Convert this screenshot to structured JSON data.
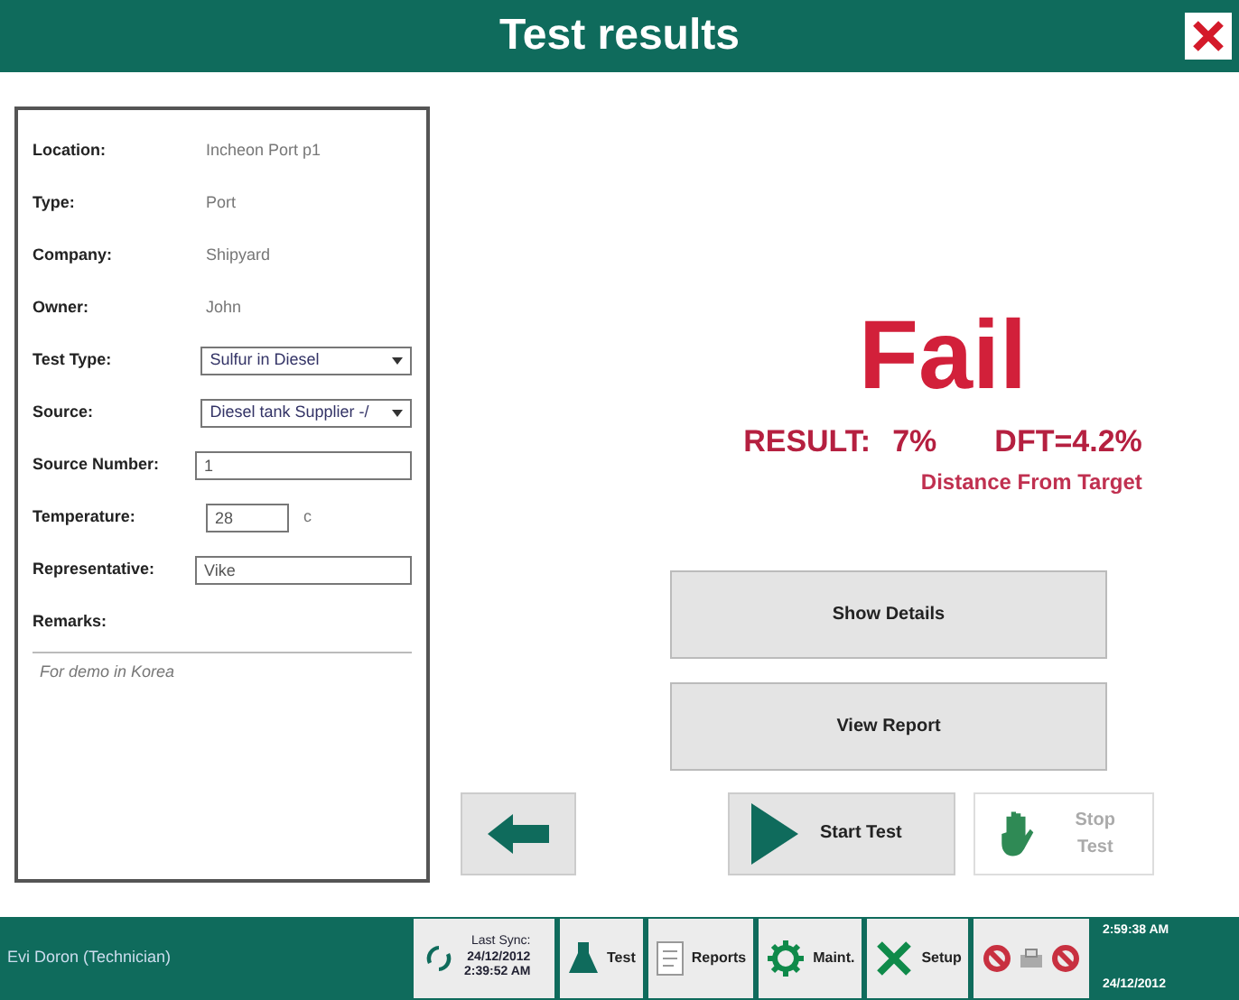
{
  "window": {
    "title": "Test results"
  },
  "fields": [
    {
      "label": "Location:",
      "kind": "text",
      "value": "Incheon Port p1"
    },
    {
      "label": "Type:",
      "kind": "text",
      "value": "Port"
    },
    {
      "label": "Company:",
      "kind": "text",
      "value": "Shipyard"
    },
    {
      "label": "Owner:",
      "kind": "text",
      "value": "John"
    },
    {
      "label": "Test Type:",
      "kind": "select",
      "value": "Sulfur in Diesel"
    },
    {
      "label": "Source:",
      "kind": "select",
      "value": "Diesel tank Supplier -/"
    },
    {
      "label": "Source Number:",
      "kind": "input",
      "value": "1"
    },
    {
      "label": "Temperature:",
      "kind": "input",
      "value": "28",
      "unit": "c"
    },
    {
      "label": "Representative:",
      "kind": "input",
      "value": "Vike"
    }
  ],
  "remarks": {
    "label": "Remarks:",
    "value": "For demo in Korea"
  },
  "result": {
    "verdict": "Fail",
    "result_label": "RESULT:",
    "result_value": "7%",
    "dft": "DFT=4.2%",
    "dft_caption": "Distance From Target"
  },
  "actions": [
    {
      "label": "Show Details"
    },
    {
      "label": "View Report"
    }
  ],
  "controls": [
    {
      "kind": "back"
    },
    {
      "kind": "start",
      "label": "Start Test",
      "disabled": false
    },
    {
      "kind": "stop",
      "label": "Stop Test",
      "disabled": true
    }
  ],
  "status_bar": {
    "user": "Evi Doron (Technician)",
    "sync": {
      "label": "Last Sync:",
      "date": "24/12/2012",
      "time": "2:39:52 AM"
    },
    "nav": [
      {
        "kind": "test",
        "label": "Test"
      },
      {
        "kind": "reports",
        "label": "Reports"
      },
      {
        "kind": "maint",
        "label": "Maint."
      },
      {
        "kind": "setup",
        "label": "Setup"
      }
    ],
    "clock": {
      "time": "2:59:38 AM",
      "date": "24/12/2012"
    }
  }
}
